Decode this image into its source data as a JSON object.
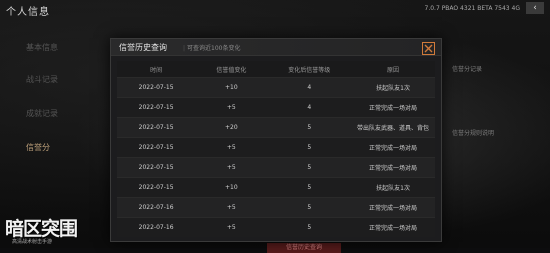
{
  "page": {
    "title": "个人信息",
    "status_text": "7.0.7 PBAO 4321 BETA 7543 4G"
  },
  "side_nav": {
    "items": [
      {
        "label": "基本信息"
      },
      {
        "label": "战斗记录"
      },
      {
        "label": "成就记录"
      },
      {
        "label": "信誉分",
        "active": true
      }
    ]
  },
  "right_panel": {
    "labels": [
      "信誉分记录",
      "信誉分规则说明"
    ]
  },
  "dialog": {
    "title": "信誉历史查询",
    "subtitle": "可查询近100条变化",
    "columns": [
      "时间",
      "信誉值变化",
      "变化后信誉等级",
      "原因"
    ],
    "rows": [
      [
        "2022-07-15",
        "+10",
        "4",
        "扶起队友1次"
      ],
      [
        "2022-07-15",
        "+5",
        "4",
        "正常完成一场对局"
      ],
      [
        "2022-07-15",
        "+20",
        "5",
        "带出队友武器、道具、背包"
      ],
      [
        "2022-07-15",
        "+5",
        "5",
        "正常完成一场对局"
      ],
      [
        "2022-07-15",
        "+5",
        "5",
        "正常完成一场对局"
      ],
      [
        "2022-07-15",
        "+10",
        "5",
        "扶起队友1次"
      ],
      [
        "2022-07-16",
        "+5",
        "5",
        "正常完成一场对局"
      ],
      [
        "2022-07-16",
        "+5",
        "5",
        "正常完成一场对局"
      ]
    ]
  },
  "bottom_button": {
    "label": "信誉历史查询"
  },
  "logo": {
    "text": "暗区突围",
    "sub": "高清战术射击手游"
  },
  "colors": {
    "accent": "#d07a3a",
    "active_nav": "#bda07a",
    "dialog_bg": "#1c1c1e"
  }
}
